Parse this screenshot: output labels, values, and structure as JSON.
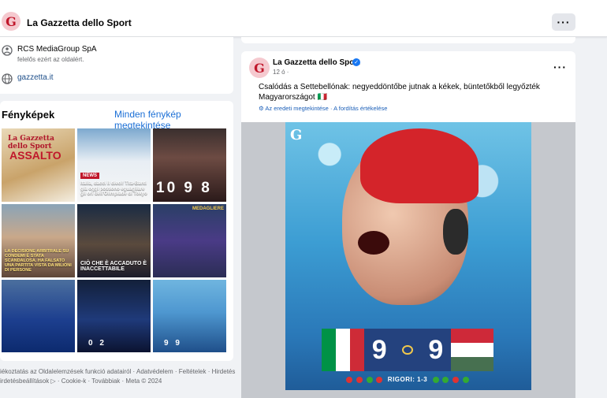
{
  "header": {
    "logo_letter": "G",
    "page_name": "La Gazzetta dello Sport",
    "more_label": "···"
  },
  "about": {
    "company": "RCS MediaGroup SpA",
    "company_note": "felelős ezért az oldalért.",
    "website": "gazzetta.it"
  },
  "photos": {
    "title": "Fényképek",
    "see_all": "Minden fénykép megtekintése",
    "tiles": [
      {
        "caption": "ASSALTO",
        "head": "La Gazzetta dello Sport"
      },
      {
        "caption": "Italia, dacci il dieci! Tita-Banti già oggi possono eguagliare gli ori dell'Olimpiade di Tokyo",
        "badge": "NEWS"
      },
      {
        "caption": "10 9 8"
      },
      {
        "caption": "LA DECISIONE ARBITRALE SU CONDEMI È STATA SCANDALOSA. HA FALSATO UNA PARTITA VISTA DA MILIONI DI PERSONE"
      },
      {
        "caption": "CIÒ CHE È ACCADUTO È INACCETTABILE"
      },
      {
        "caption": "MEDAGLIERE"
      },
      {
        "caption": ""
      },
      {
        "caption": "0 2"
      },
      {
        "caption": "9 9"
      }
    ]
  },
  "footer": {
    "line1": "iékoztatás az Oldalelemzések funkció adatairól · Adatvédelem · Feltételek · Hirdetés",
    "line2": "irdetésbeállítások ▷ · Cookie-k · Továbbiak · Meta © 2024"
  },
  "post": {
    "author": "La Gazzetta dello Sport",
    "time": "12 ó ·",
    "text": "Csalódás a Settebellónak: negyeddöntőbe jutnak a kékek, büntetőkből legyőzték Magyarországot 🇮🇹",
    "translation": "⚙ Az eredeti megtekintése · A fordítás értékelése",
    "more_label": "···",
    "image": {
      "logo": "G",
      "score_left": "9",
      "score_right": "9",
      "shootout": "RIGORI: 1-3"
    }
  },
  "colors": {
    "brand": "#c0172b",
    "link": "#1b6fd6",
    "verified": "#1877f2"
  }
}
